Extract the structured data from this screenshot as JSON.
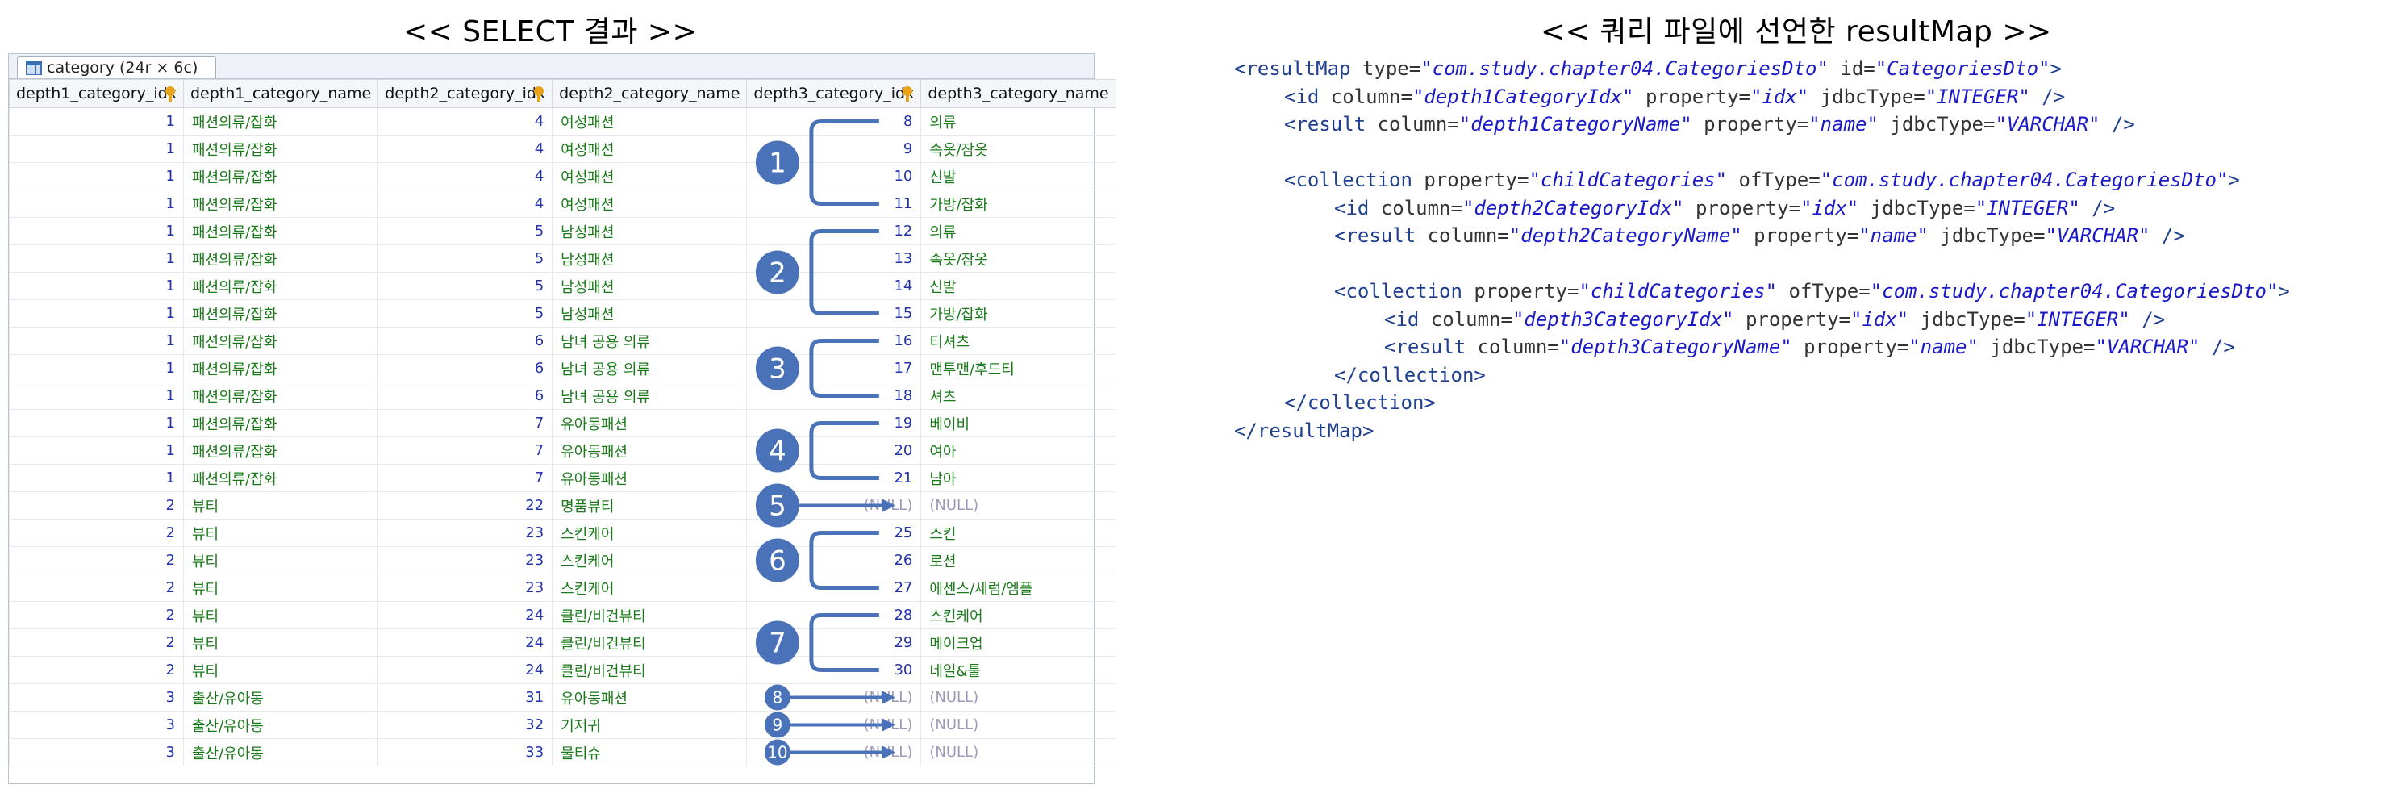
{
  "headings": {
    "left": "<< SELECT 결과 >>",
    "right": "<< 쿼리 파일에 선언한 resultMap >>"
  },
  "grid_tab": {
    "label": "category (24r × 6c)"
  },
  "columns": [
    {
      "label": "depth1_category_idx",
      "key": true
    },
    {
      "label": "depth1_category_name",
      "key": false
    },
    {
      "label": "depth2_category_idx",
      "key": true
    },
    {
      "label": "depth2_category_name",
      "key": false
    },
    {
      "label": "depth3_category_idx",
      "key": true
    },
    {
      "label": "depth3_category_name",
      "key": false
    }
  ],
  "rows": [
    [
      "1",
      "패션의류/잡화",
      "4",
      "여성패션",
      "8",
      "의류"
    ],
    [
      "1",
      "패션의류/잡화",
      "4",
      "여성패션",
      "9",
      "속옷/잠옷"
    ],
    [
      "1",
      "패션의류/잡화",
      "4",
      "여성패션",
      "10",
      "신발"
    ],
    [
      "1",
      "패션의류/잡화",
      "4",
      "여성패션",
      "11",
      "가방/잡화"
    ],
    [
      "1",
      "패션의류/잡화",
      "5",
      "남성패션",
      "12",
      "의류"
    ],
    [
      "1",
      "패션의류/잡화",
      "5",
      "남성패션",
      "13",
      "속옷/잠옷"
    ],
    [
      "1",
      "패션의류/잡화",
      "5",
      "남성패션",
      "14",
      "신발"
    ],
    [
      "1",
      "패션의류/잡화",
      "5",
      "남성패션",
      "15",
      "가방/잡화"
    ],
    [
      "1",
      "패션의류/잡화",
      "6",
      "남녀 공용 의류",
      "16",
      "티셔츠"
    ],
    [
      "1",
      "패션의류/잡화",
      "6",
      "남녀 공용 의류",
      "17",
      "맨투맨/후드티"
    ],
    [
      "1",
      "패션의류/잡화",
      "6",
      "남녀 공용 의류",
      "18",
      "셔츠"
    ],
    [
      "1",
      "패션의류/잡화",
      "7",
      "유아동패션",
      "19",
      "베이비"
    ],
    [
      "1",
      "패션의류/잡화",
      "7",
      "유아동패션",
      "20",
      "여아"
    ],
    [
      "1",
      "패션의류/잡화",
      "7",
      "유아동패션",
      "21",
      "남아"
    ],
    [
      "2",
      "뷰티",
      "22",
      "명품뷰티",
      "(NULL)",
      "(NULL)"
    ],
    [
      "2",
      "뷰티",
      "23",
      "스킨케어",
      "25",
      "스킨"
    ],
    [
      "2",
      "뷰티",
      "23",
      "스킨케어",
      "26",
      "로션"
    ],
    [
      "2",
      "뷰티",
      "23",
      "스킨케어",
      "27",
      "에센스/세럼/엠플"
    ],
    [
      "2",
      "뷰티",
      "24",
      "클린/비건뷰티",
      "28",
      "스킨케어"
    ],
    [
      "2",
      "뷰티",
      "24",
      "클린/비건뷰티",
      "29",
      "메이크업"
    ],
    [
      "2",
      "뷰티",
      "24",
      "클린/비건뷰티",
      "30",
      "네일&툴"
    ],
    [
      "3",
      "출산/유아동",
      "31",
      "유아동패션",
      "(NULL)",
      "(NULL)"
    ],
    [
      "3",
      "출산/유아동",
      "32",
      "기저귀",
      "(NULL)",
      "(NULL)"
    ],
    [
      "3",
      "출산/유아동",
      "33",
      "물티슈",
      "(NULL)",
      "(NULL)"
    ]
  ],
  "annotations": {
    "color": "#4a72b8",
    "brackets": [
      {
        "label": "1",
        "first_row": 0,
        "last_row": 3
      },
      {
        "label": "2",
        "first_row": 4,
        "last_row": 7
      },
      {
        "label": "3",
        "first_row": 8,
        "last_row": 10
      },
      {
        "label": "4",
        "first_row": 11,
        "last_row": 13
      },
      {
        "label": "6",
        "first_row": 15,
        "last_row": 17
      },
      {
        "label": "7",
        "first_row": 18,
        "last_row": 20
      }
    ],
    "arrows": [
      {
        "label": "5",
        "row": 14,
        "large": true
      },
      {
        "label": "8",
        "row": 21,
        "large": false
      },
      {
        "label": "9",
        "row": 22,
        "large": false
      },
      {
        "label": "10",
        "row": 23,
        "large": false
      }
    ]
  },
  "code_lines": [
    {
      "indent": 0,
      "parts": [
        [
          "tag",
          "<resultMap "
        ],
        [
          "attr",
          "type="
        ],
        [
          "val",
          "\"com.study.chapter04.CategoriesDto\""
        ],
        [
          "attr",
          " id="
        ],
        [
          "val",
          "\"CategoriesDto\""
        ],
        [
          "tag",
          ">"
        ]
      ]
    },
    {
      "indent": 1,
      "parts": [
        [
          "tag",
          "<id "
        ],
        [
          "attr",
          "column="
        ],
        [
          "val",
          "\"depth1CategoryIdx\""
        ],
        [
          "attr",
          " property="
        ],
        [
          "val",
          "\"idx\""
        ],
        [
          "attr",
          " jdbcType="
        ],
        [
          "val",
          "\"INTEGER\""
        ],
        [
          "tag",
          " />"
        ]
      ]
    },
    {
      "indent": 1,
      "parts": [
        [
          "tag",
          "<result "
        ],
        [
          "attr",
          "column="
        ],
        [
          "val",
          "\"depth1CategoryName\""
        ],
        [
          "attr",
          " property="
        ],
        [
          "val",
          "\"name\""
        ],
        [
          "attr",
          " jdbcType="
        ],
        [
          "val",
          "\"VARCHAR\""
        ],
        [
          "tag",
          " />"
        ]
      ]
    },
    {
      "indent": 0,
      "parts": []
    },
    {
      "indent": 1,
      "parts": [
        [
          "tag",
          "<collection "
        ],
        [
          "attr",
          "property="
        ],
        [
          "val",
          "\"childCategories\""
        ],
        [
          "attr",
          " ofType="
        ],
        [
          "val",
          "\"com.study.chapter04.CategoriesDto\""
        ],
        [
          "tag",
          ">"
        ]
      ]
    },
    {
      "indent": 2,
      "parts": [
        [
          "tag",
          "<id "
        ],
        [
          "attr",
          "column="
        ],
        [
          "val",
          "\"depth2CategoryIdx\""
        ],
        [
          "attr",
          " property="
        ],
        [
          "val",
          "\"idx\""
        ],
        [
          "attr",
          " jdbcType="
        ],
        [
          "val",
          "\"INTEGER\""
        ],
        [
          "tag",
          " />"
        ]
      ]
    },
    {
      "indent": 2,
      "parts": [
        [
          "tag",
          "<result "
        ],
        [
          "attr",
          "column="
        ],
        [
          "val",
          "\"depth2CategoryName\""
        ],
        [
          "attr",
          " property="
        ],
        [
          "val",
          "\"name\""
        ],
        [
          "attr",
          " jdbcType="
        ],
        [
          "val",
          "\"VARCHAR\""
        ],
        [
          "tag",
          " />"
        ]
      ]
    },
    {
      "indent": 0,
      "parts": []
    },
    {
      "indent": 2,
      "parts": [
        [
          "tag",
          "<collection "
        ],
        [
          "attr",
          "property="
        ],
        [
          "val",
          "\"childCategories\""
        ],
        [
          "attr",
          " ofType="
        ],
        [
          "val",
          "\"com.study.chapter04.CategoriesDto\""
        ],
        [
          "tag",
          ">"
        ]
      ]
    },
    {
      "indent": 3,
      "parts": [
        [
          "tag",
          "<id "
        ],
        [
          "attr",
          "column="
        ],
        [
          "val",
          "\"depth3CategoryIdx\""
        ],
        [
          "attr",
          " property="
        ],
        [
          "val",
          "\"idx\""
        ],
        [
          "attr",
          " jdbcType="
        ],
        [
          "val",
          "\"INTEGER\""
        ],
        [
          "tag",
          " />"
        ]
      ]
    },
    {
      "indent": 3,
      "parts": [
        [
          "tag",
          "<result "
        ],
        [
          "attr",
          "column="
        ],
        [
          "val",
          "\"depth3CategoryName\""
        ],
        [
          "attr",
          " property="
        ],
        [
          "val",
          "\"name\""
        ],
        [
          "attr",
          " jdbcType="
        ],
        [
          "val",
          "\"VARCHAR\""
        ],
        [
          "tag",
          " />"
        ]
      ]
    },
    {
      "indent": 2,
      "parts": [
        [
          "tag",
          "</collection>"
        ]
      ]
    },
    {
      "indent": 1,
      "parts": [
        [
          "tag",
          "</collection>"
        ]
      ]
    },
    {
      "indent": 0,
      "parts": [
        [
          "tag",
          "</resultMap>"
        ]
      ]
    }
  ]
}
